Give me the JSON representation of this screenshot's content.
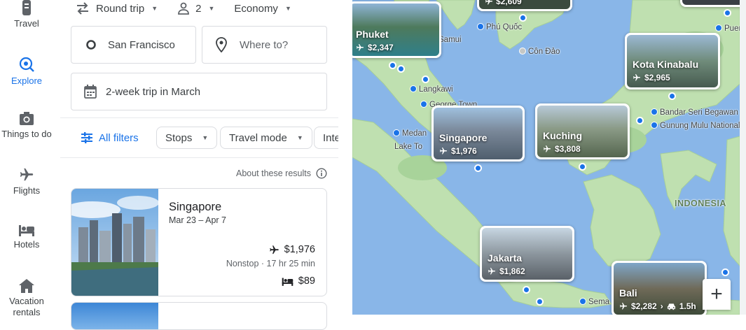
{
  "nav": {
    "items": [
      {
        "label": "Travel",
        "icon": "suitcase-icon"
      },
      {
        "label": "Explore",
        "icon": "explore-icon",
        "active": true
      },
      {
        "label": "Things to do",
        "icon": "camera-icon"
      },
      {
        "label": "Flights",
        "icon": "airplane-icon"
      },
      {
        "label": "Hotels",
        "icon": "bed-icon"
      },
      {
        "label": "Vacation rentals",
        "icon": "house-icon"
      }
    ]
  },
  "search": {
    "trip_type": "Round trip",
    "passengers": "2",
    "cabin_class": "Economy",
    "origin": "San Francisco",
    "destination_placeholder": "Where to?",
    "dates": "2-week trip in March"
  },
  "filters": {
    "all_filters": "All filters",
    "stops": "Stops",
    "travel_mode": "Travel mode",
    "interests": "Inte"
  },
  "results": {
    "about_label": "About these results",
    "items": [
      {
        "destination": "Singapore",
        "dates": "Mar 23 – Apr 7",
        "flight_price": "$1,976",
        "flight_details": "Nonstop · 17 hr 25 min",
        "hotel_price": "$89"
      }
    ]
  },
  "map": {
    "region_label": "INDONESIA",
    "places": [
      "Phú Quốc",
      "Côn Đảo",
      "Samui",
      "Langkawi",
      "George Town",
      "Medan",
      "Lake To",
      "Bandar Seri Begawan",
      "Gunung Mulu National",
      "Puer",
      "Sema"
    ],
    "cards": [
      {
        "name": "Phuket",
        "price": "$2,347"
      },
      {
        "name": "Kota Kinabalu",
        "price": "$2,965"
      },
      {
        "name": "Singapore",
        "price": "$1,976"
      },
      {
        "name": "Kuching",
        "price": "$3,808"
      },
      {
        "name": "Jakarta",
        "price": "$1,862"
      },
      {
        "name": "Bali",
        "price": "$2,282",
        "drive": "1.5h"
      },
      {
        "name": "",
        "price": "$2,609"
      }
    ],
    "zoom_in": "+"
  },
  "colors": {
    "accent": "#1a73e8",
    "sea": "#89b6e8",
    "land": "#bfe0b0",
    "land_dark": "#a8d39a"
  }
}
